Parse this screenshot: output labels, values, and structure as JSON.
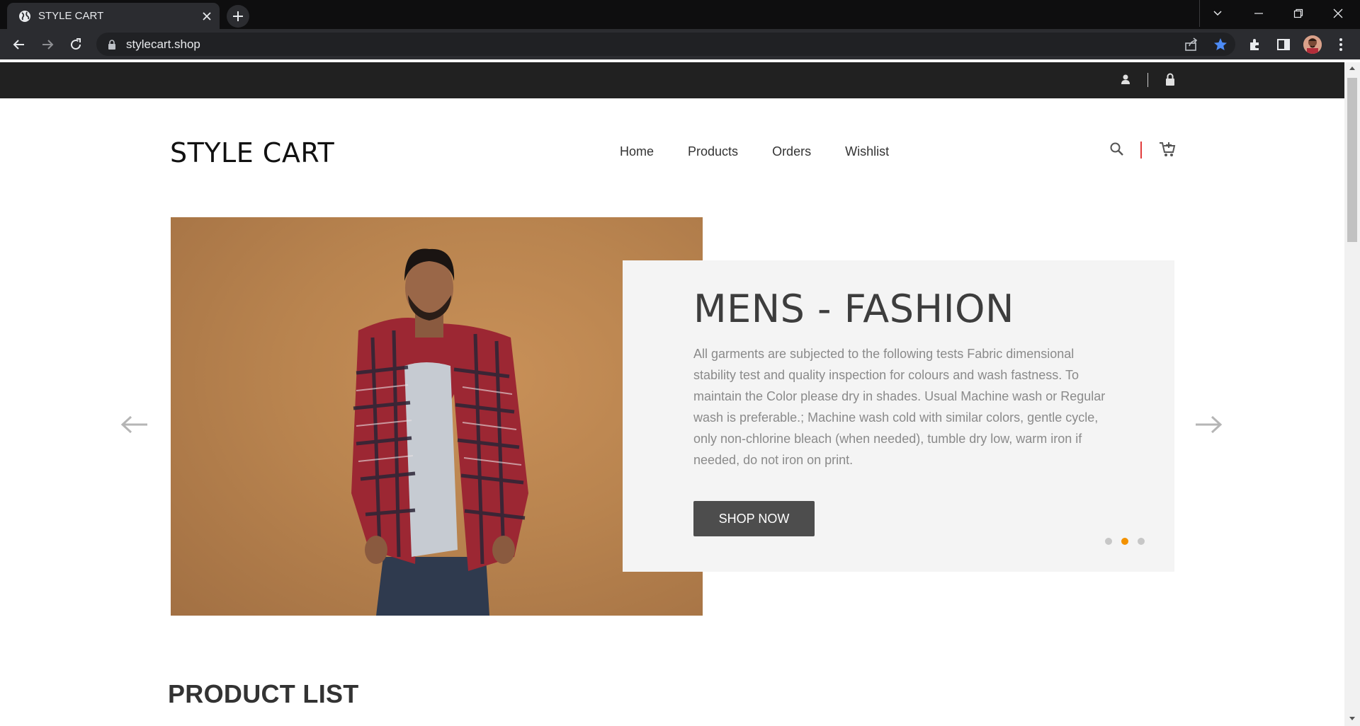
{
  "browser": {
    "tab_title": "STYLE CART",
    "url": "stylecart.shop",
    "icons": [
      "globe-icon",
      "close-icon",
      "plus-icon",
      "back-icon",
      "forward-icon",
      "reload-icon",
      "lock-icon",
      "share-icon",
      "star-icon",
      "extensions-icon",
      "side-panel-icon",
      "avatar",
      "kebab-menu-icon"
    ]
  },
  "site": {
    "topbar": {
      "icons": [
        "user-icon",
        "lock-icon"
      ]
    },
    "brand": "STYLE CART",
    "nav": [
      "Home",
      "Products",
      "Orders",
      "Wishlist"
    ],
    "header_icons": [
      "search-icon",
      "cart-icon"
    ]
  },
  "hero": {
    "title": "MENS - FASHION",
    "description": "All garments are subjected to the following tests Fabric dimensional stability test and quality inspection for colours and wash fastness. To maintain the Color please dry in shades. Usual Machine wash or Regular wash is preferable.; Machine wash cold with similar colors, gentle cycle, only non-chlorine bleach (when needed), tumble dry low, warm iron if needed, do not iron on print.",
    "button": "SHOP NOW",
    "slides": 3,
    "active_slide": 2
  },
  "section": {
    "title": "PRODUCT LIST"
  },
  "colors": {
    "accent": "#f39200",
    "topbar": "#212121",
    "button": "#4d4d4d",
    "divider_red": "#e23b3b",
    "star_blue": "#4d8bf5"
  }
}
